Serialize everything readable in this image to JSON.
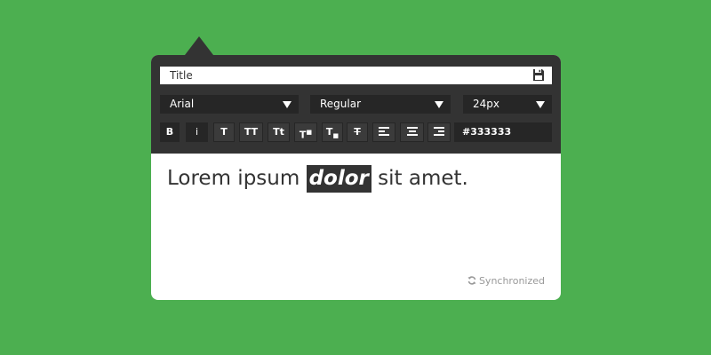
{
  "title_field": {
    "value": "Title"
  },
  "font_select": {
    "value": "Arial"
  },
  "weight_select": {
    "value": "Regular"
  },
  "size_select": {
    "value": "24px"
  },
  "format_buttons": {
    "bold": "B",
    "italic": "i",
    "text": "T",
    "uppercase": "TT",
    "capitalize": "Tt",
    "superscript": "T",
    "subscript": "T",
    "strikethrough": "T"
  },
  "color_field": {
    "value": "#333333"
  },
  "content": {
    "before": "Lorem ipsum ",
    "highlighted": "dolor",
    "after": " sit amet."
  },
  "status": {
    "text": "Synchronized"
  },
  "colors": {
    "background": "#4caf50",
    "toolbar": "#333333",
    "control": "#262626",
    "text": "#333333",
    "status": "#999999"
  },
  "icons": [
    "save-icon",
    "dropdown-arrow-icon",
    "align-left-icon",
    "align-center-icon",
    "align-right-icon",
    "sync-icon"
  ]
}
